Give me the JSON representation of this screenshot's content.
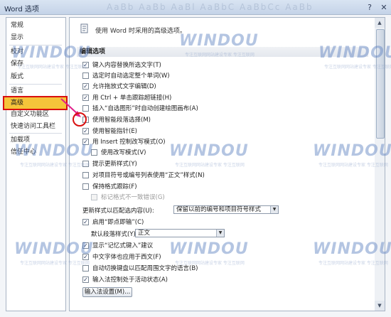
{
  "window": {
    "title": "Word 选项",
    "ghost_text": "AaBb AaBb AaBl AaBbC AaBbCc AaBb"
  },
  "sidebar": {
    "items": [
      {
        "label": "常规"
      },
      {
        "label": "显示"
      },
      {
        "label": "校对"
      },
      {
        "label": "保存"
      },
      {
        "label": "版式"
      },
      {
        "label": "语言"
      },
      {
        "label": "高级"
      },
      {
        "label": "自定义功能区"
      },
      {
        "label": "快速访问工具栏"
      },
      {
        "label": "加载项"
      },
      {
        "label": "信任中心"
      }
    ],
    "selected": "高级"
  },
  "content": {
    "header": "使用 Word 时采用的高级选项。",
    "section_title": "编辑选项",
    "options": [
      {
        "label": "键入内容替换所选文字(T)",
        "checked": true
      },
      {
        "label": "选定时自动选定整个单词(W)",
        "checked": false
      },
      {
        "label": "允许拖放式文字编辑(D)",
        "checked": true
      },
      {
        "label": "用 Ctrl + 单击跟踪超链接(H)",
        "checked": true
      },
      {
        "label": "插入“自选图形”时自动创建绘图画布(A)",
        "checked": false
      },
      {
        "label": "使用智能段落选择(M)",
        "checked": false
      },
      {
        "label": "使用智能指针(E)",
        "checked": true
      },
      {
        "label": "用 Insert 控制改写模式(O)",
        "checked": true
      },
      {
        "label": "使用改写模式(V)",
        "checked": false
      },
      {
        "label": "提示更新样式(Y)",
        "checked": false
      },
      {
        "label": "对项目符号或编号列表使用“正文”样式(N)",
        "checked": false
      },
      {
        "label": "保持格式跟踪(F)",
        "checked": false
      },
      {
        "label": "标记格式不一致错误(G)",
        "checked": false,
        "disabled": true
      }
    ],
    "update_style_label": "更新样式以匹配选内容(U):",
    "update_style_value": "保留以前的编号和项目符号样式",
    "click_and_type": {
      "label": "启用“即点即输”(C)",
      "checked": true
    },
    "default_para_label": "默认段落样式(Y):",
    "default_para_value": "正文",
    "options2": [
      {
        "label": "显示“记忆式键入”建议",
        "checked": true
      },
      {
        "label": "中文字体也应用于西文(F)",
        "checked": true
      },
      {
        "label": "自动切换键盘以匹配周围文字的语言(B)",
        "checked": false
      },
      {
        "label": "输入法控制处于活动状态(A)",
        "checked": true
      }
    ],
    "ime_button": "输入法设置(M)..."
  },
  "watermark": {
    "text_main": "WINDOU",
    "text_sub": "专注互联网网站建设专家 专注互联网"
  },
  "colors": {
    "highlight": "#f5c43a",
    "annotation_red": "#d81010",
    "annotation_magenta": "#e0208a"
  }
}
